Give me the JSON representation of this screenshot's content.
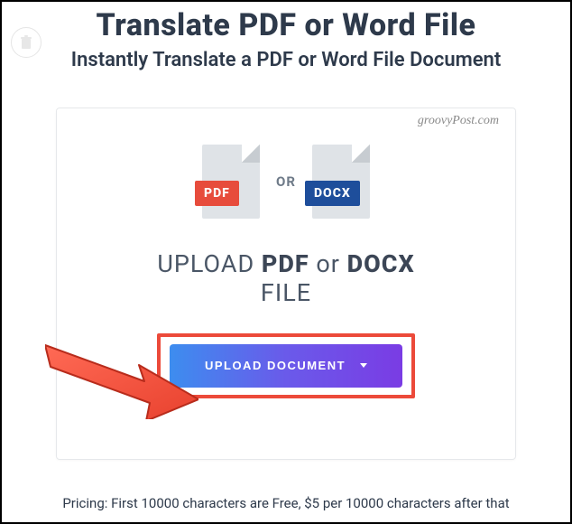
{
  "heading": {
    "title": "Translate PDF or Word File",
    "subtitle": "Instantly Translate a PDF or Word File Document"
  },
  "watermark": "groovyPost.com",
  "file_icons": {
    "pdf_label": "PDF",
    "separator": "OR",
    "docx_label": "DOCX"
  },
  "upload": {
    "line_prefix": "UPLOAD ",
    "bold1": "PDF",
    "mid": " or ",
    "bold2": "DOCX",
    "line2": "FILE",
    "button_label": "UPLOAD DOCUMENT"
  },
  "pricing": "Pricing: First 10000 characters are Free, $5 per 10000 characters after that"
}
